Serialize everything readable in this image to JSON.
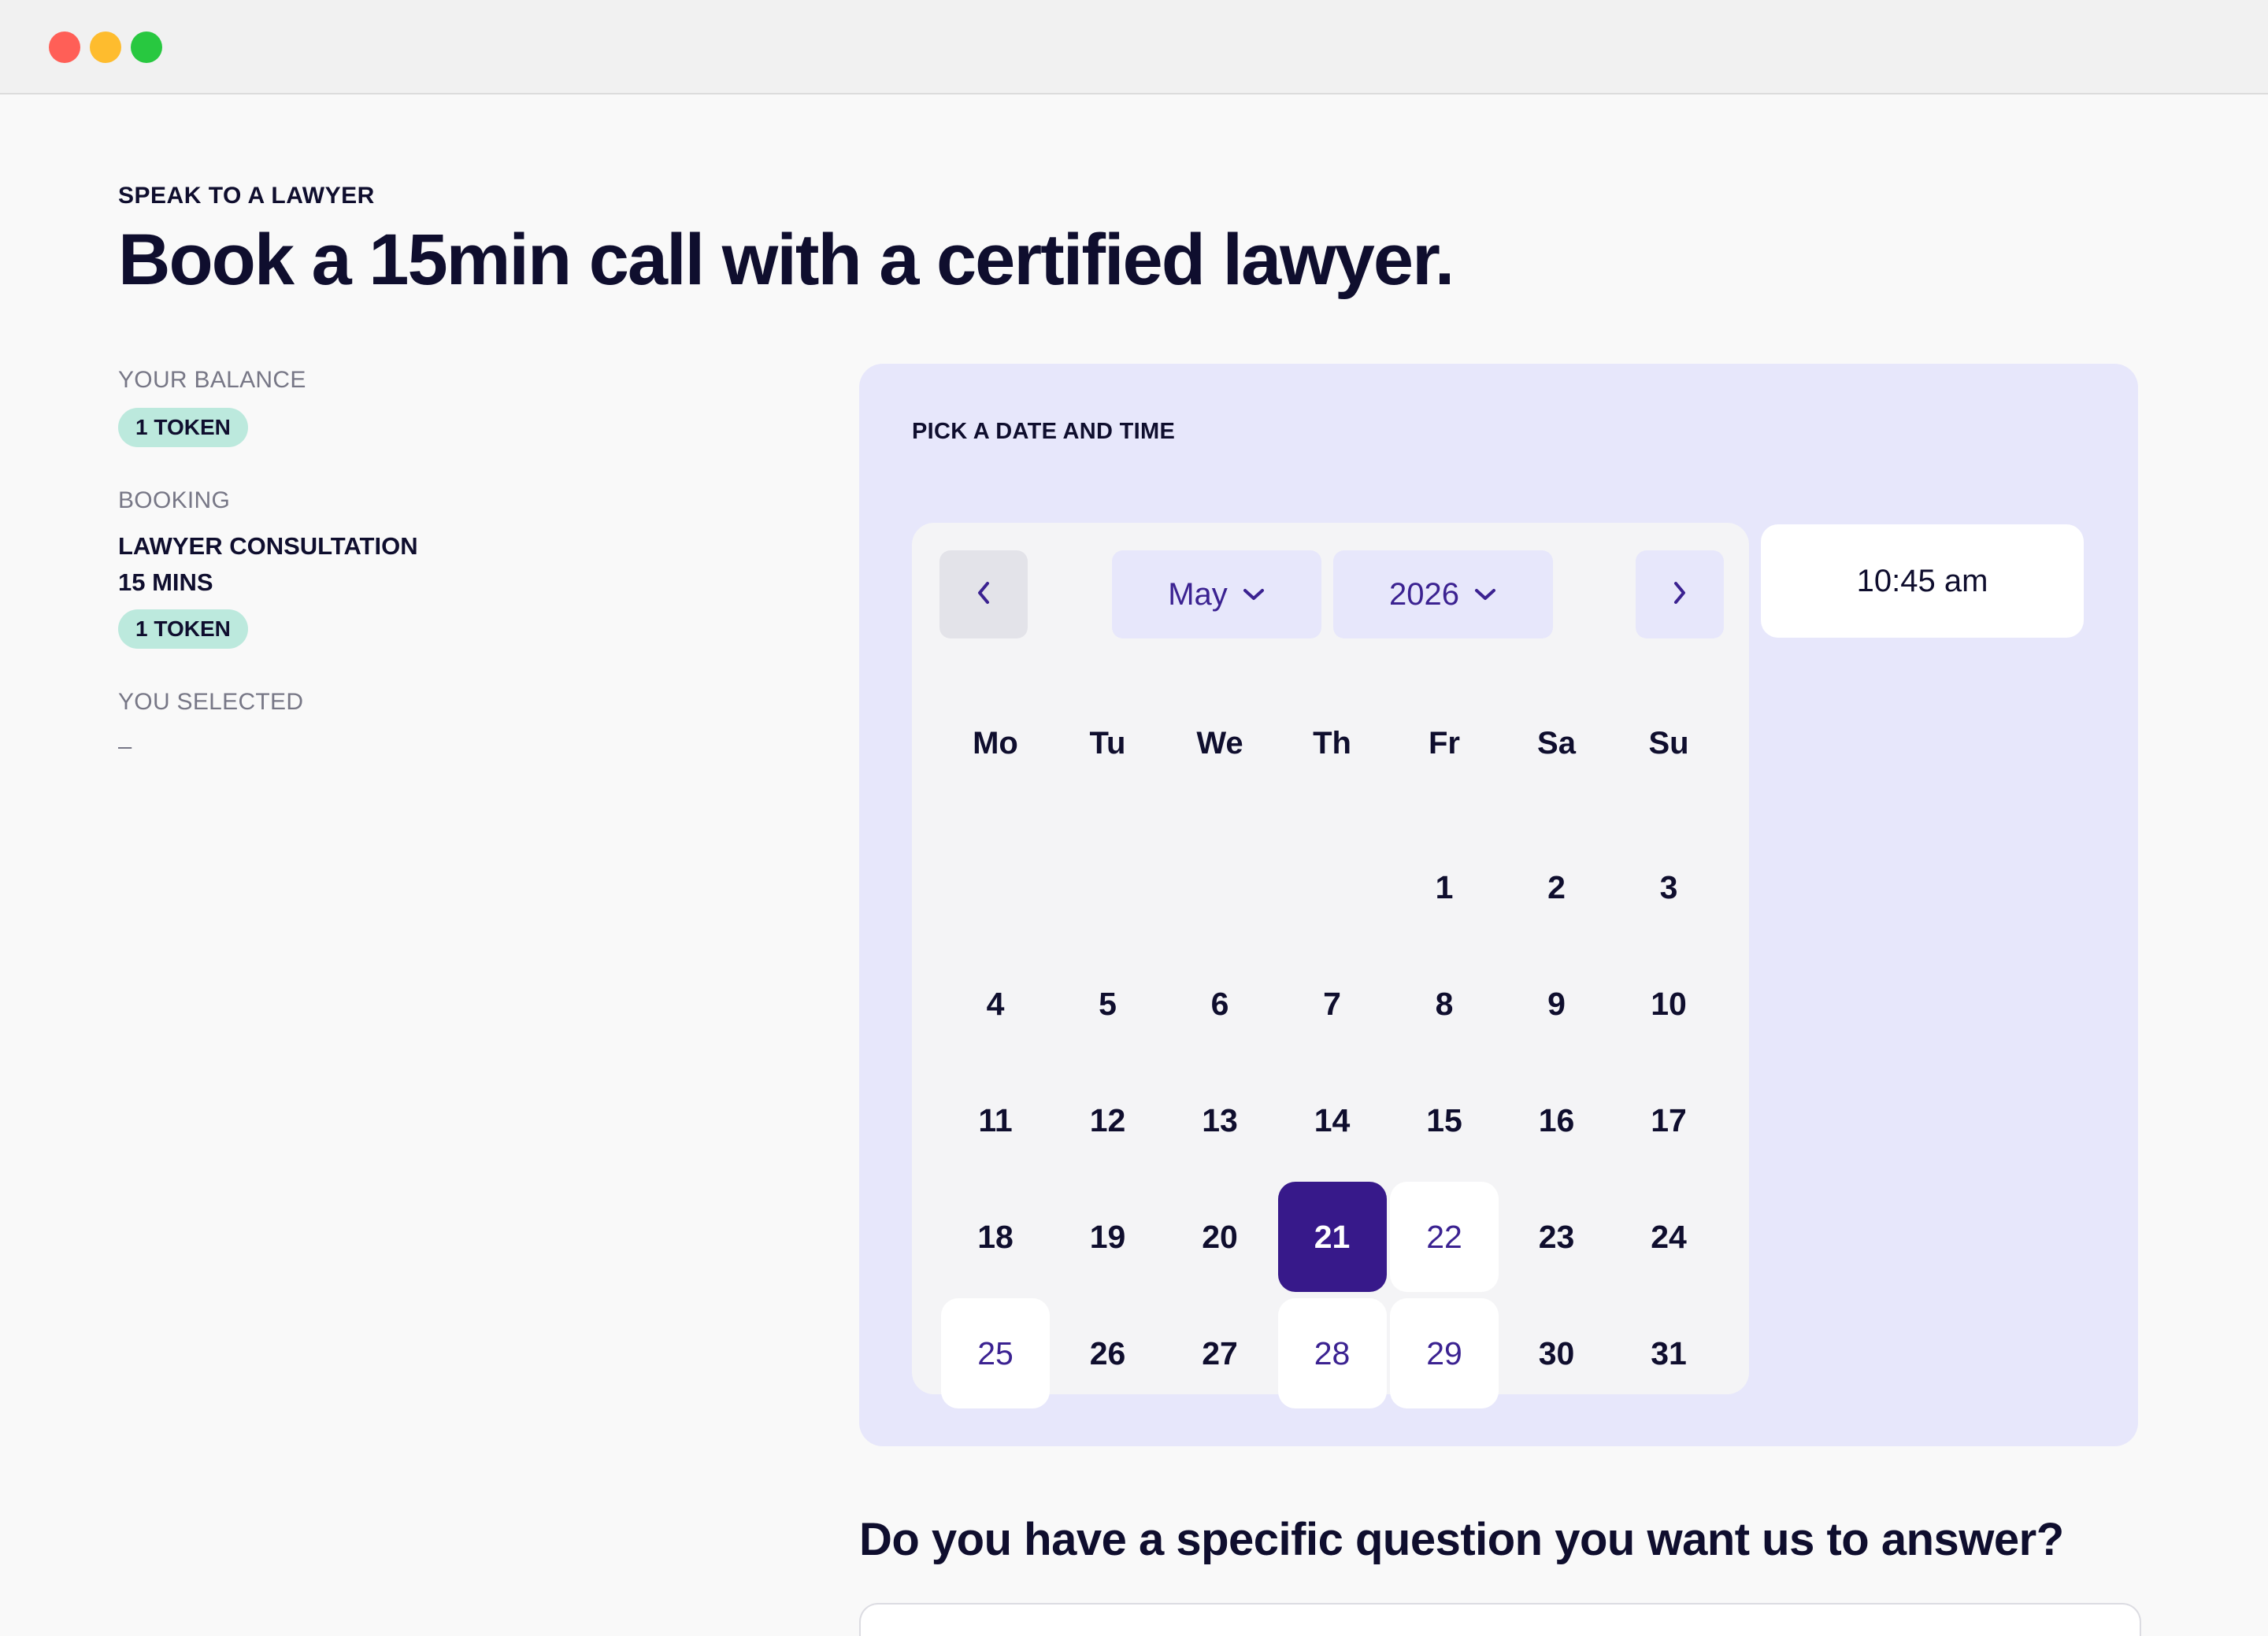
{
  "header": {
    "eyebrow": "SPEAK TO A LAWYER",
    "title": "Book a 15min call with a certified lawyer."
  },
  "sidebar": {
    "balance_label": "YOUR BALANCE",
    "balance_value": "1 TOKEN",
    "booking_label": "BOOKING",
    "booking_item": "LAWYER CONSULTATION",
    "booking_duration": "15 MINS",
    "booking_cost": "1 TOKEN",
    "selected_label": "YOU SELECTED",
    "selected_value": "–"
  },
  "picker": {
    "label": "PICK A DATE AND TIME",
    "month": "May",
    "year": "2026",
    "weekdays": [
      "Mo",
      "Tu",
      "We",
      "Th",
      "Fr",
      "Sa",
      "Su"
    ],
    "first_weekday_index": 4,
    "days_in_month": 31,
    "selected_day": 21,
    "available_days": [
      22,
      25,
      28,
      29
    ],
    "time_slot": "10:45 am"
  },
  "question": {
    "heading": "Do you have a specific question you want us to answer?"
  },
  "icons": {
    "prev": "chevron-left-icon",
    "next": "chevron-right-icon",
    "dropdown": "chevron-down-icon"
  },
  "colors": {
    "accent": "#37198A",
    "panel": "#E7E7FB",
    "token_pill": "#BCE9DD"
  }
}
